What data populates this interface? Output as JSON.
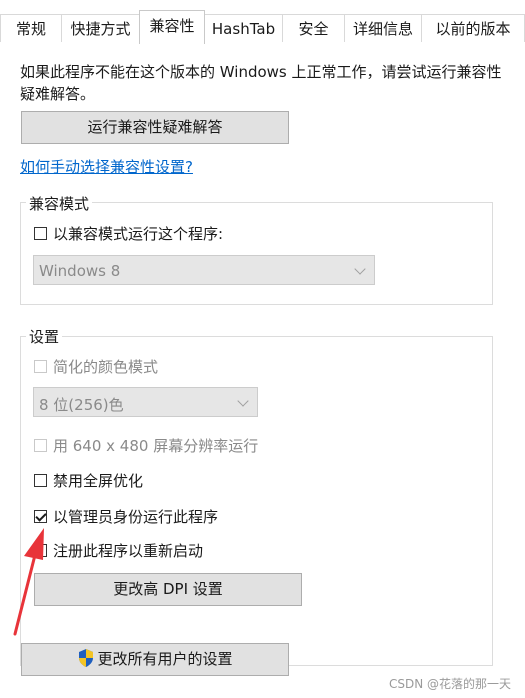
{
  "tabs": [
    {
      "label": "常规"
    },
    {
      "label": "快捷方式"
    },
    {
      "label": "兼容性"
    },
    {
      "label": "HashTab"
    },
    {
      "label": "安全"
    },
    {
      "label": "详细信息"
    },
    {
      "label": "以前的版本"
    }
  ],
  "active_tab": "兼容性",
  "intro_text": "如果此程序不能在这个版本的 Windows 上正常工作，请尝试运行兼容性疑难解答。",
  "troubleshoot_button": "运行兼容性疑难解答",
  "manual_link": "如何手动选择兼容性设置?",
  "compat_mode": {
    "label": "兼容模式",
    "checkbox_label": "以兼容模式运行这个程序:",
    "checked": false,
    "os_selected": "Windows 8"
  },
  "settings": {
    "label": "设置",
    "reduced_color": {
      "label": "简化的颜色模式",
      "checked": false,
      "enabled": false
    },
    "color_selected": "8 位(256)色",
    "resolution": {
      "label": "用 640 x 480 屏幕分辨率运行",
      "checked": false,
      "enabled": false
    },
    "fullscreen_opt": {
      "label": "禁用全屏优化",
      "checked": false,
      "enabled": true
    },
    "run_admin": {
      "label": "以管理员身份运行此程序",
      "checked": true,
      "enabled": true
    },
    "register_restart": {
      "label": "注册此程序以重新启动",
      "checked": false,
      "enabled": true
    },
    "dpi_button": "更改高 DPI 设置"
  },
  "all_users_button": "更改所有用户的设置",
  "watermark": "CSDN @花落的那一天",
  "colors": {
    "link": "#0066cc",
    "arrow": "#e8343a",
    "shield_blue": "#1e5fbf",
    "shield_yellow": "#f3c425"
  }
}
